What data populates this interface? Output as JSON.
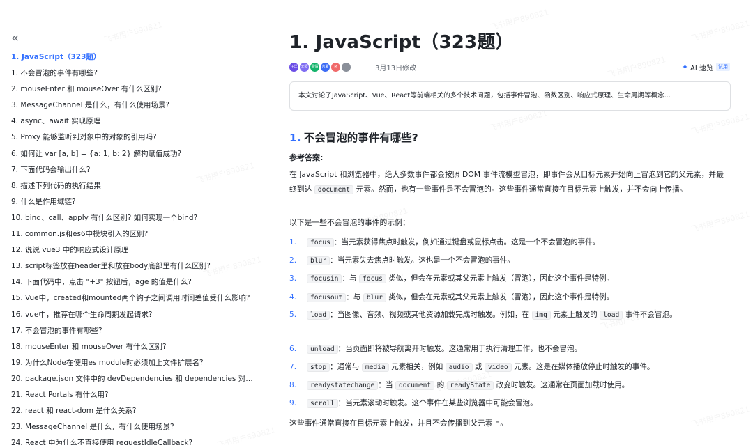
{
  "watermark": "飞书用户890821",
  "sidebar": {
    "collapse_icon": "«",
    "items": [
      "1. JavaScript（323题）",
      "1. 不会冒泡的事件有哪些?",
      "2. mouseEnter 和 mouseOver 有什么区别?",
      "3. MessageChannel 是什么，有什么使用场景?",
      "4. async、await 实现原理",
      "5. Proxy 能够监听到对象中的对象的引用吗?",
      "6. 如何让 var [a, b] = {a: 1, b: 2} 解构赋值成功?",
      "7. 下面代码会输出什么?",
      "8. 描述下列代码的执行结果",
      "9. 什么是作用域链?",
      "10. bind、call、apply 有什么区别? 如何实现一个bind?",
      "11. common.js和es6中模块引入的区别?",
      "12. 说说 vue3 中的响应式设计原理",
      "13. script标签放在header里和放在body底部里有什么区别?",
      "14. 下面代码中，点击 \"+3\" 按钮后，age 的值是什么?",
      "15. Vue中，created和mounted两个钩子之间调用时间差值受什么影响?",
      "16. vue中，推荐在哪个生命周期发起请求?",
      "17. 不会冒泡的事件有哪些?",
      "18. mouseEnter 和 mouseOver 有什么区别?",
      "19. 为什么Node在使用es module时必须加上文件扩展名?",
      "20. package.json 文件中的 devDependencies 和 dependencies 对象有...",
      "21. React Portals 有什么用?",
      "22. react 和 react-dom 是什么关系?",
      "23. MessageChannel 是什么，有什么使用场景?",
      "24. React 中为什么不直接使用 requestIdleCallback?"
    ]
  },
  "doc": {
    "title": "1. JavaScript（323题）",
    "avatars": [
      {
        "label": "汪洋",
        "color": "#6b4de6"
      },
      {
        "label": "天阳",
        "color": "#7f6df2"
      },
      {
        "label": "墨情",
        "color": "#14b36b"
      },
      {
        "label": "吉夏",
        "color": "#3d6cf5"
      },
      {
        "label": "M",
        "color": "#f06a6a"
      },
      {
        "label": "",
        "color": "#8a8f99"
      }
    ],
    "modified": "3月13日修改",
    "ai_label": "AI 速览",
    "ai_badge": "试用",
    "summary": "本文讨论了JavaScript、Vue、React等前端相关的多个技术问题，包括事件冒泡、函数区别、响应式原理、生命周期等概念...",
    "section_num": "1.",
    "section_title": "不会冒泡的事件有哪些?",
    "ref_label": "参考答案:",
    "intro": {
      "p1": "在 JavaScript 和浏览器中，绝大多数事件都会按照 DOM 事件流模型冒泡，即事件会从目标元素开始向上冒泡到它的父元素，并最终到达 ",
      "code": "document",
      "p2": " 元素。然而，也有一些事件是不会冒泡的。这些事件通常直接在目标元素上触发，并不会向上传播。"
    },
    "list_intro": "以下是一些不会冒泡的事件的示例：",
    "items": [
      {
        "n": "1.",
        "code": "focus",
        "text": "：当元素获得焦点时触发，例如通过键盘或鼠标点击。这是一个不会冒泡的事件。"
      },
      {
        "n": "2.",
        "code": "blur",
        "text": "：当元素失去焦点时触发。这也是一个不会冒泡的事件。"
      },
      {
        "n": "3.",
        "code": "focusin",
        "t1": "：与 ",
        "code2": "focus",
        "text": " 类似，但会在元素或其父元素上触发（冒泡），因此这个事件是特例。"
      },
      {
        "n": "4.",
        "code": "focusout",
        "t1": "：与 ",
        "code2": "blur",
        "text": " 类似，但会在元素或其父元素上触发（冒泡），因此这个事件是特例。"
      },
      {
        "n": "5.",
        "code": "load",
        "t1": "：当图像、音频、视频或其他资源加载完成时触发。例如，在 ",
        "code2": "img",
        "t2": " 元素上触发的 ",
        "code3": "load",
        "text": " 事件不会冒泡。"
      },
      {
        "n": "6.",
        "code": "unload",
        "text": "：当页面即将被导航离开时触发。这通常用于执行清理工作，也不会冒泡。"
      },
      {
        "n": "7.",
        "code": "stop",
        "t1": "：通常与 ",
        "code2": "media",
        "t2": " 元素相关，例如 ",
        "code3": "audio",
        "t3": " 或 ",
        "code4": "video",
        "text": " 元素。这是在媒体播放停止时触发的事件。"
      },
      {
        "n": "8.",
        "code": "readystatechange",
        "t1": "：当 ",
        "code2": "document",
        "t2": " 的 ",
        "code3": "readyState",
        "text": " 改变时触发。这通常在页面加载时使用。"
      },
      {
        "n": "9.",
        "code": "scroll",
        "text": "：当元素滚动时触发。这个事件在某些浏览器中可能会冒泡。"
      }
    ],
    "closing": "这些事件通常直接在目标元素上触发，并且不会传播到父元素上。"
  }
}
